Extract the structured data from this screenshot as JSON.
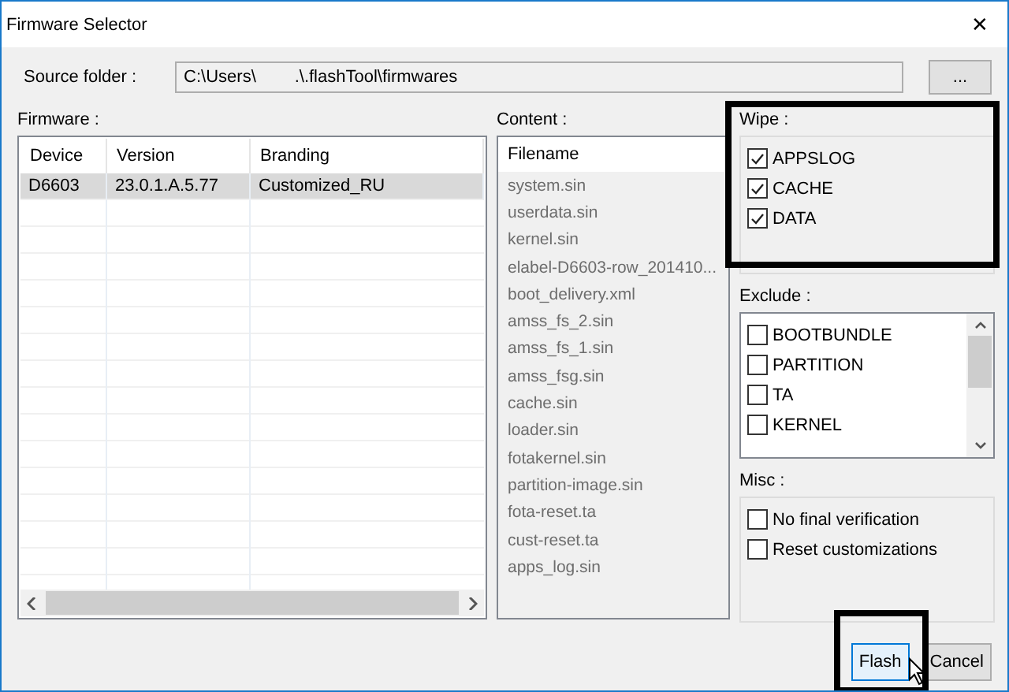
{
  "window": {
    "title": "Firmware Selector",
    "close": "✕"
  },
  "source": {
    "label": "Source folder :",
    "value": "C:\\Users\\        .\\.flashTool\\firmwares",
    "browse": "..."
  },
  "firmware": {
    "label": "Firmware :",
    "columns": [
      "Device",
      "Version",
      "Branding"
    ],
    "rows": [
      {
        "cells": [
          "D6603",
          "23.0.1.A.5.77",
          "Customized_RU"
        ],
        "selected": true
      }
    ]
  },
  "content": {
    "label": "Content :",
    "column": "Filename",
    "files": [
      "system.sin",
      "userdata.sin",
      "kernel.sin",
      "elabel-D6603-row_201410...",
      "boot_delivery.xml",
      "amss_fs_2.sin",
      "amss_fs_1.sin",
      "amss_fsg.sin",
      "cache.sin",
      "loader.sin",
      "fotakernel.sin",
      "partition-image.sin",
      "fota-reset.ta",
      "cust-reset.ta",
      "apps_log.sin"
    ]
  },
  "wipe": {
    "label": "Wipe :",
    "items": [
      {
        "label": "APPSLOG",
        "checked": true
      },
      {
        "label": "CACHE",
        "checked": true
      },
      {
        "label": "DATA",
        "checked": true
      }
    ]
  },
  "exclude": {
    "label": "Exclude :",
    "items": [
      {
        "label": "BOOTBUNDLE",
        "checked": false
      },
      {
        "label": "PARTITION",
        "checked": false
      },
      {
        "label": "TA",
        "checked": false
      },
      {
        "label": "KERNEL",
        "checked": false
      }
    ]
  },
  "misc": {
    "label": "Misc :",
    "items": [
      {
        "label": "No final verification",
        "checked": false
      },
      {
        "label": "Reset customizations",
        "checked": false
      }
    ]
  },
  "buttons": [
    {
      "label": "Flash",
      "focused": true
    },
    {
      "label": "Cancel",
      "focused": false
    }
  ]
}
